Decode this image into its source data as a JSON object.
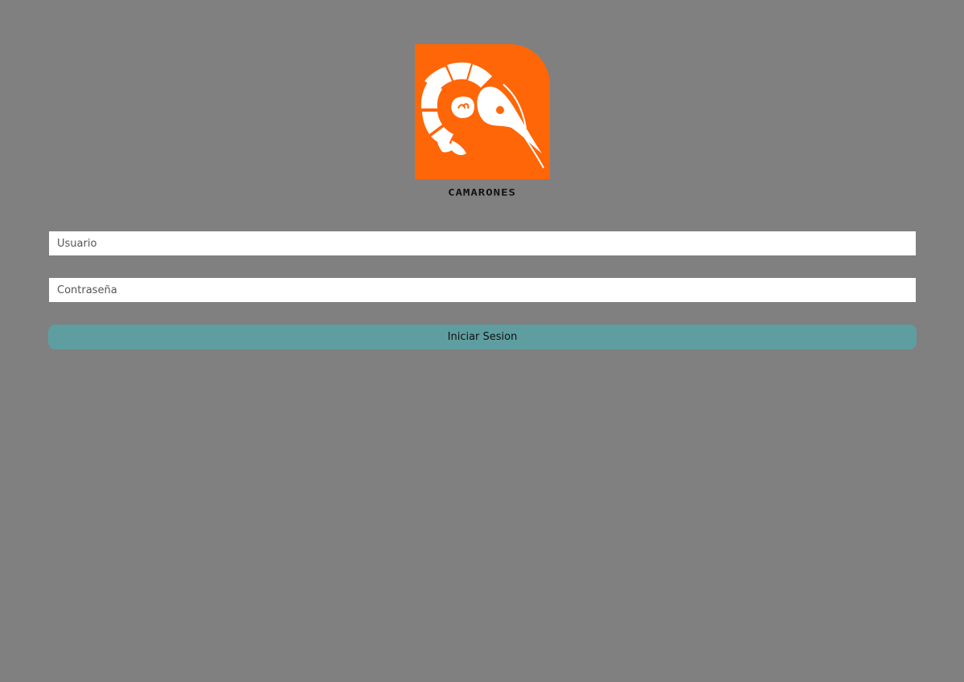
{
  "brand": {
    "name": "CAMARONES",
    "logo_icon": "shrimp-icon",
    "logo_color": "#ff6608"
  },
  "form": {
    "username_placeholder": "Usuario",
    "username_value": "",
    "password_placeholder": "Contraseña",
    "password_value": "",
    "submit_label": "Iniciar Sesion",
    "submit_color": "#5f9ea0"
  },
  "page": {
    "background_color": "#808080"
  }
}
